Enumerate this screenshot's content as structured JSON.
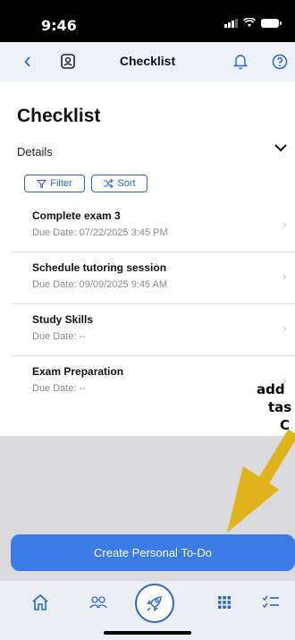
{
  "status_bar": {
    "time": "9:46"
  },
  "nav": {
    "title": "Checklist",
    "icons": [
      "back-chevron-icon",
      "contact-book-icon",
      "bell-icon",
      "help-icon"
    ]
  },
  "page": {
    "title": "Checklist",
    "details_label": "Details",
    "filter_label": "Filter",
    "sort_label": "Sort"
  },
  "tasks": [
    {
      "title": "Complete exam 3",
      "due": "Due Date: 07/22/2025 3:45 PM"
    },
    {
      "title": "Schedule tutoring session",
      "due": "Due Date: 09/09/2025 9:45 AM"
    },
    {
      "title": "Study Skills",
      "due": "Due Date: --"
    },
    {
      "title": "Exam Preparation",
      "due": "Due Date: --"
    }
  ],
  "overlay": {
    "line1": "add",
    "line2": "tas",
    "line3": "C"
  },
  "cta": {
    "label": "Create Personal To-Do"
  },
  "tab_bar": {
    "icons": [
      "home-icon",
      "people-icon",
      "rocket-icon",
      "grid-icon",
      "checklist-icon"
    ]
  },
  "colors": {
    "accent": "#3b7be6",
    "annotation_arrow": "#e0b21b"
  }
}
